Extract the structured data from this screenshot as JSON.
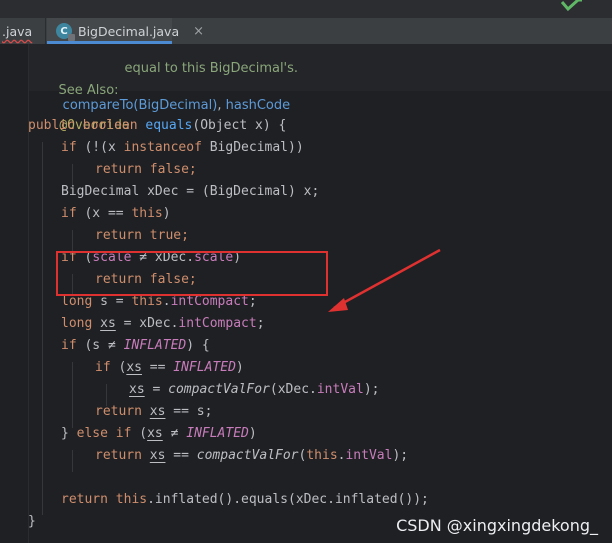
{
  "tabs": [
    {
      "label": ".java",
      "active": false,
      "has_error": true
    },
    {
      "label": "BigDecimal.java",
      "active": true,
      "icon": "class-icon-locked"
    }
  ],
  "icons": {
    "run": "run-check-icon",
    "close": "close-icon"
  },
  "javadoc": {
    "line1": "equal to this BigDecimal's.",
    "see_also_label": "See Also:",
    "see_also_link1": "compareTo(BigDecimal)",
    "see_also_separator": ", ",
    "see_also_link2": "hashCode"
  },
  "code": {
    "annotation": "@Override",
    "signature": [
      "public boolean ",
      "equals",
      "(Object x) {"
    ],
    "l1": [
      "if (!(x ",
      "instanceof",
      " BigDecimal))"
    ],
    "l2": [
      "return false;"
    ],
    "l3": [
      "BigDecimal xDec = (BigDecimal) x;"
    ],
    "l4": [
      "if",
      " (x == ",
      "this",
      ")"
    ],
    "l5": [
      "return true;"
    ],
    "l6": [
      "if",
      " (",
      "scale",
      " ≠ xDec.",
      "scale",
      ")"
    ],
    "l7": [
      "return false;"
    ],
    "l8": [
      "long",
      " s = ",
      "this",
      ".",
      "intCompact",
      ";"
    ],
    "l9": [
      "long ",
      "xs",
      " = xDec.",
      "intCompact",
      ";"
    ],
    "l10": [
      "if",
      " (s ≠ ",
      "INFLATED",
      ") {"
    ],
    "l11": [
      "if",
      " (",
      "xs",
      " == ",
      "INFLATED",
      ")"
    ],
    "l12": [
      "xs",
      " = ",
      "compactValFor",
      "(xDec.",
      "intVal",
      ");"
    ],
    "l13": [
      "return ",
      "xs",
      " == s;"
    ],
    "l14": [
      "} ",
      "else if",
      " (",
      "xs",
      " ≠ ",
      "INFLATED",
      ")"
    ],
    "l15": [
      "return ",
      "xs",
      " == ",
      "compactValFor",
      "(",
      "this",
      ".",
      "intVal",
      ");"
    ],
    "l16": [
      "return ",
      "this",
      ".inflated().equals(xDec.inflated());"
    ],
    "closing": "}"
  },
  "annotation_overlay": {
    "box_color": "#e03131",
    "arrow_color": "#e03131"
  },
  "watermark": "CSDN @xingxingdekong_",
  "colors": {
    "background": "#1f2023",
    "keyword": "#cf8e6d",
    "method": "#56a8f5",
    "field": "#c77dbb",
    "annotation": "#b3ae60",
    "text": "#bcbec4"
  }
}
